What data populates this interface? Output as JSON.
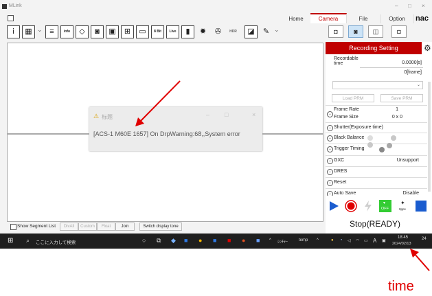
{
  "app": {
    "title": "MLink",
    "window_controls": {
      "minimize": "–",
      "maximize": "□",
      "close": "×"
    },
    "logo_text": "nac"
  },
  "menu_tabs": [
    "Home",
    "Camera",
    "File",
    "Option"
  ],
  "toolbar": {
    "info_label": "info",
    "bit_label": "8 Bit",
    "live_label": "Live",
    "hdr_label": "HDR"
  },
  "recording_setting": {
    "header": "Recording Setting",
    "recordable_time_label": "Recordable time",
    "recordable_time_value": "0.0000[s]",
    "frame_value": "0[frame]",
    "load_prm": "Load PRM",
    "save_prm": "Save PRM",
    "frame_rate_label": "Frame Rate",
    "frame_rate_value": "1",
    "frame_size_label": "Frame Size",
    "frame_size_value": "0 x 0",
    "rows": [
      {
        "label": "Shutter(Exposure time)",
        "value": ""
      },
      {
        "label": "Black Balance",
        "value": ""
      },
      {
        "label": "Trigger Timing",
        "value": ""
      },
      {
        "label": "GXC",
        "value": "Unsupport"
      },
      {
        "label": "DRES",
        "value": ""
      },
      {
        "label": "Reset",
        "value": ""
      },
      {
        "label": "Auto Save",
        "value": "Disable"
      }
    ]
  },
  "controls": {
    "off_label": "OFF",
    "fps_label": "0pps",
    "status": "Stop(READY)"
  },
  "bottom_bar": {
    "show_segment_list": "Show Segment List",
    "buttons": [
      "DivAll",
      "Custom",
      "Float",
      "Join"
    ],
    "switch_tone": "Switch display tone"
  },
  "dialog": {
    "title": "标题",
    "message": "[ACS-1 M60E 1657] On DrpWarning:68,,System error"
  },
  "taskbar": {
    "search_placeholder": "ここに入力して検索",
    "tray_text_1": "ｼﾝﾁｬｰ",
    "tray_text_2": "temp",
    "tray_lang": "A",
    "time": "18:45",
    "date": "2024/02/13",
    "notification_count": "24"
  },
  "annotation": {
    "label": "time",
    "color": "#e00000"
  },
  "colors": {
    "accent_red": "#c00000",
    "camera_tab": "#c00000",
    "taskbar_bg": "#1f1f1f",
    "play_blue": "#1a5ccf",
    "toggle_green": "#33cc33"
  }
}
